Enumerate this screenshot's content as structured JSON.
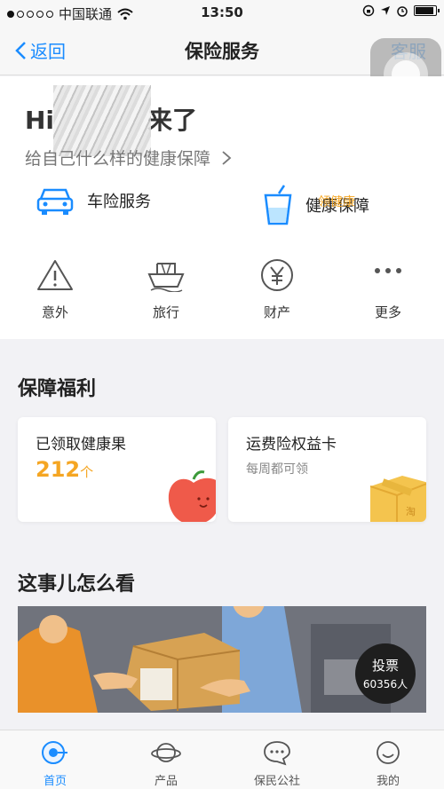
{
  "status_bar": {
    "carrier": "中国联通",
    "time": "13:50"
  },
  "nav": {
    "back_label": "返回",
    "title": "保险服务",
    "service_label": "客服"
  },
  "greeting": {
    "visible_prefix": "Hi",
    "visible_suffix": "来了",
    "subtitle": "给自己什么样的健康保障"
  },
  "quick_services": [
    {
      "label": "车险服务",
      "icon": "car-icon"
    },
    {
      "label": "健康保障",
      "tag": "领健康",
      "icon": "cup-icon"
    }
  ],
  "categories": [
    {
      "label": "意外",
      "icon": "warning-icon"
    },
    {
      "label": "旅行",
      "icon": "ship-icon"
    },
    {
      "label": "财产",
      "icon": "yen-icon"
    },
    {
      "label": "更多",
      "icon": "more-icon"
    }
  ],
  "benefits": {
    "title": "保障福利",
    "cards": [
      {
        "title": "已领取健康果",
        "value": "212",
        "unit": "个",
        "icon": "apple-icon"
      },
      {
        "title": "运费险权益卡",
        "subtitle": "每周都可领",
        "icon": "package-icon"
      }
    ]
  },
  "discussion": {
    "title": "这事儿怎么看",
    "vote_label": "投票",
    "vote_count": "60356人"
  },
  "tabs": [
    {
      "label": "首页",
      "icon": "home-icon",
      "active": true
    },
    {
      "label": "产品",
      "icon": "planet-icon"
    },
    {
      "label": "保民公社",
      "icon": "chat-icon"
    },
    {
      "label": "我的",
      "icon": "smile-icon"
    }
  ],
  "colors": {
    "accent": "#1a8cff",
    "highlight": "#f5a623",
    "apple": "#ef5a4a",
    "box": "#f4c44e"
  }
}
